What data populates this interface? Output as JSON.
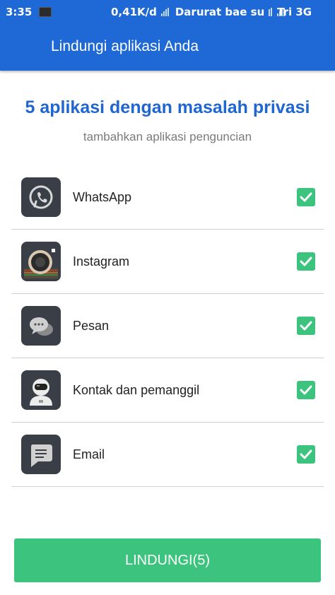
{
  "status_bar": {
    "time": "3:35",
    "speed": "0,41K/d",
    "sim1": "Darurat bae su",
    "sim2": "Tri 3G"
  },
  "app_bar": {
    "title": "Lindungi aplikasi Anda"
  },
  "headline": "5 aplikasi dengan masalah privasi",
  "subheadline": "tambahkan aplikasi penguncian",
  "apps": [
    {
      "label": "WhatsApp",
      "icon": "whatsapp-icon",
      "checked": true
    },
    {
      "label": "Instagram",
      "icon": "instagram-icon",
      "checked": true
    },
    {
      "label": "Pesan",
      "icon": "messages-icon",
      "checked": true
    },
    {
      "label": "Kontak dan pemanggil",
      "icon": "contacts-icon",
      "checked": true
    },
    {
      "label": "Email",
      "icon": "email-icon",
      "checked": true
    }
  ],
  "protect_button": {
    "label": "LINDUNGI(5)"
  },
  "colors": {
    "primary": "#1e69d6",
    "accent": "#3cc47f",
    "headline": "#1f66d0"
  }
}
